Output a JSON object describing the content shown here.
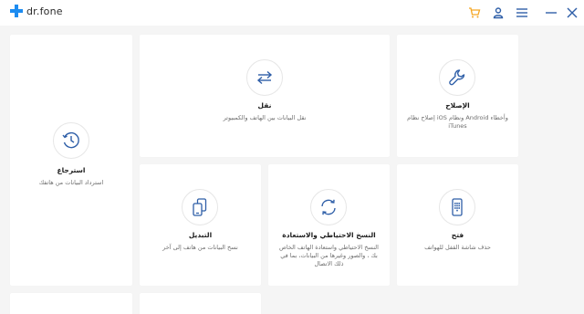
{
  "app": {
    "logo_text": "dr.fone",
    "accent_color": "#1d8cf0",
    "cart_color": "#f5a623"
  },
  "titlebar": {
    "icons": [
      "cart-icon",
      "account-icon",
      "menu-icon",
      "minimize-icon",
      "close-icon"
    ]
  },
  "modules": {
    "restore": {
      "title": "استرجاع",
      "desc": "استرداد البيانات من هاتفك",
      "icon": "clock-icon"
    },
    "transfer": {
      "title": "نقل",
      "desc": "نقل البيانات بين الهاتف والكمبيوتر",
      "icon": "transfer-arrows-icon"
    },
    "repair": {
      "title": "الإصلاح",
      "desc": "وأخطاء Android ونظام iOS إصلاح نظام iTunes",
      "icon": "wrench-icon"
    },
    "switch": {
      "title": "التبديل",
      "desc": "نسخ البيانات من هاتف إلى آخر",
      "icon": "phone-switch-icon"
    },
    "backup": {
      "title": "النسخ الاحتياطي والاستعادة",
      "desc": "النسخ الاحتياطي واستعادة الهاتف الخاص بك ، والصور وغيرها من البيانات، بما في ذلك الاتصال",
      "icon": "backup-restore-icon"
    },
    "unlock": {
      "title": "فتح",
      "desc": "حذف شاشة القفل للهواتف",
      "icon": "phone-keypad-icon"
    }
  }
}
